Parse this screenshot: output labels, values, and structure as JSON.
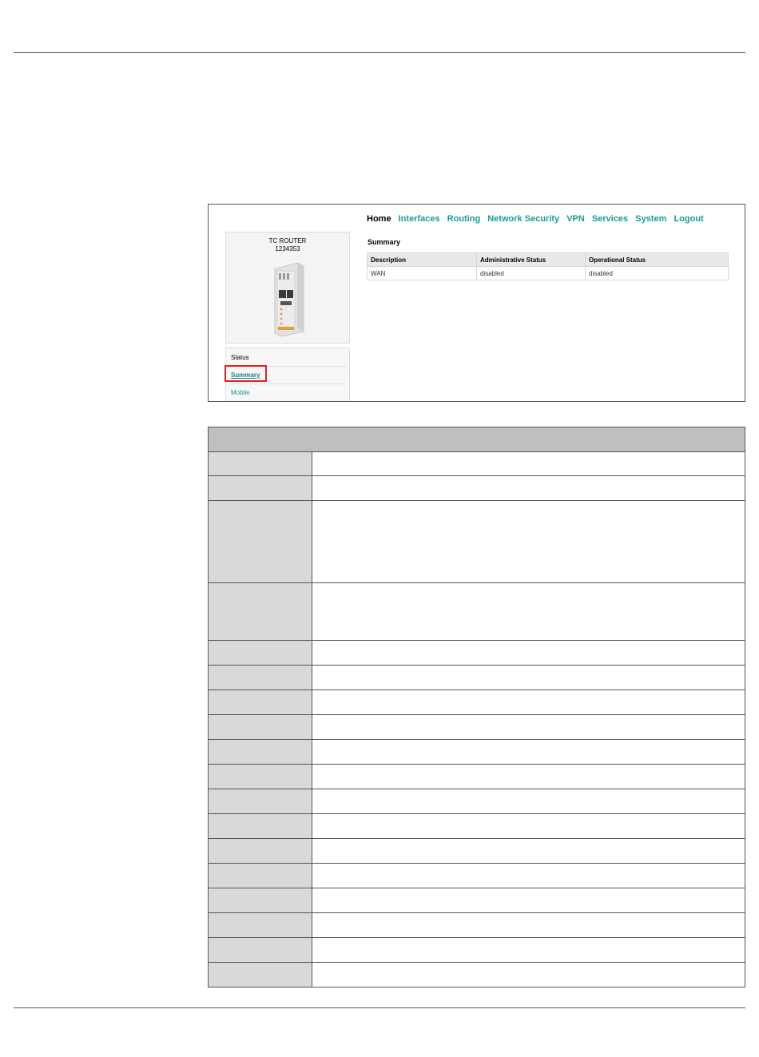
{
  "nav": [
    "Home",
    "Interfaces",
    "Routing",
    "Network Security",
    "VPN",
    "Services",
    "System",
    "Logout"
  ],
  "device": {
    "name": "TC ROUTER",
    "number": "1234353"
  },
  "menu": {
    "section": "Status",
    "summary": "Summary",
    "mobile": "Mobile"
  },
  "summary": {
    "title": "Summary",
    "columns": [
      "Description",
      "Administrative Status",
      "Operational Status"
    ],
    "row": [
      "WAN",
      "disabled",
      "disabled"
    ]
  },
  "colors": {
    "link": "#1a9a9a",
    "highlight": "#e0201f"
  }
}
